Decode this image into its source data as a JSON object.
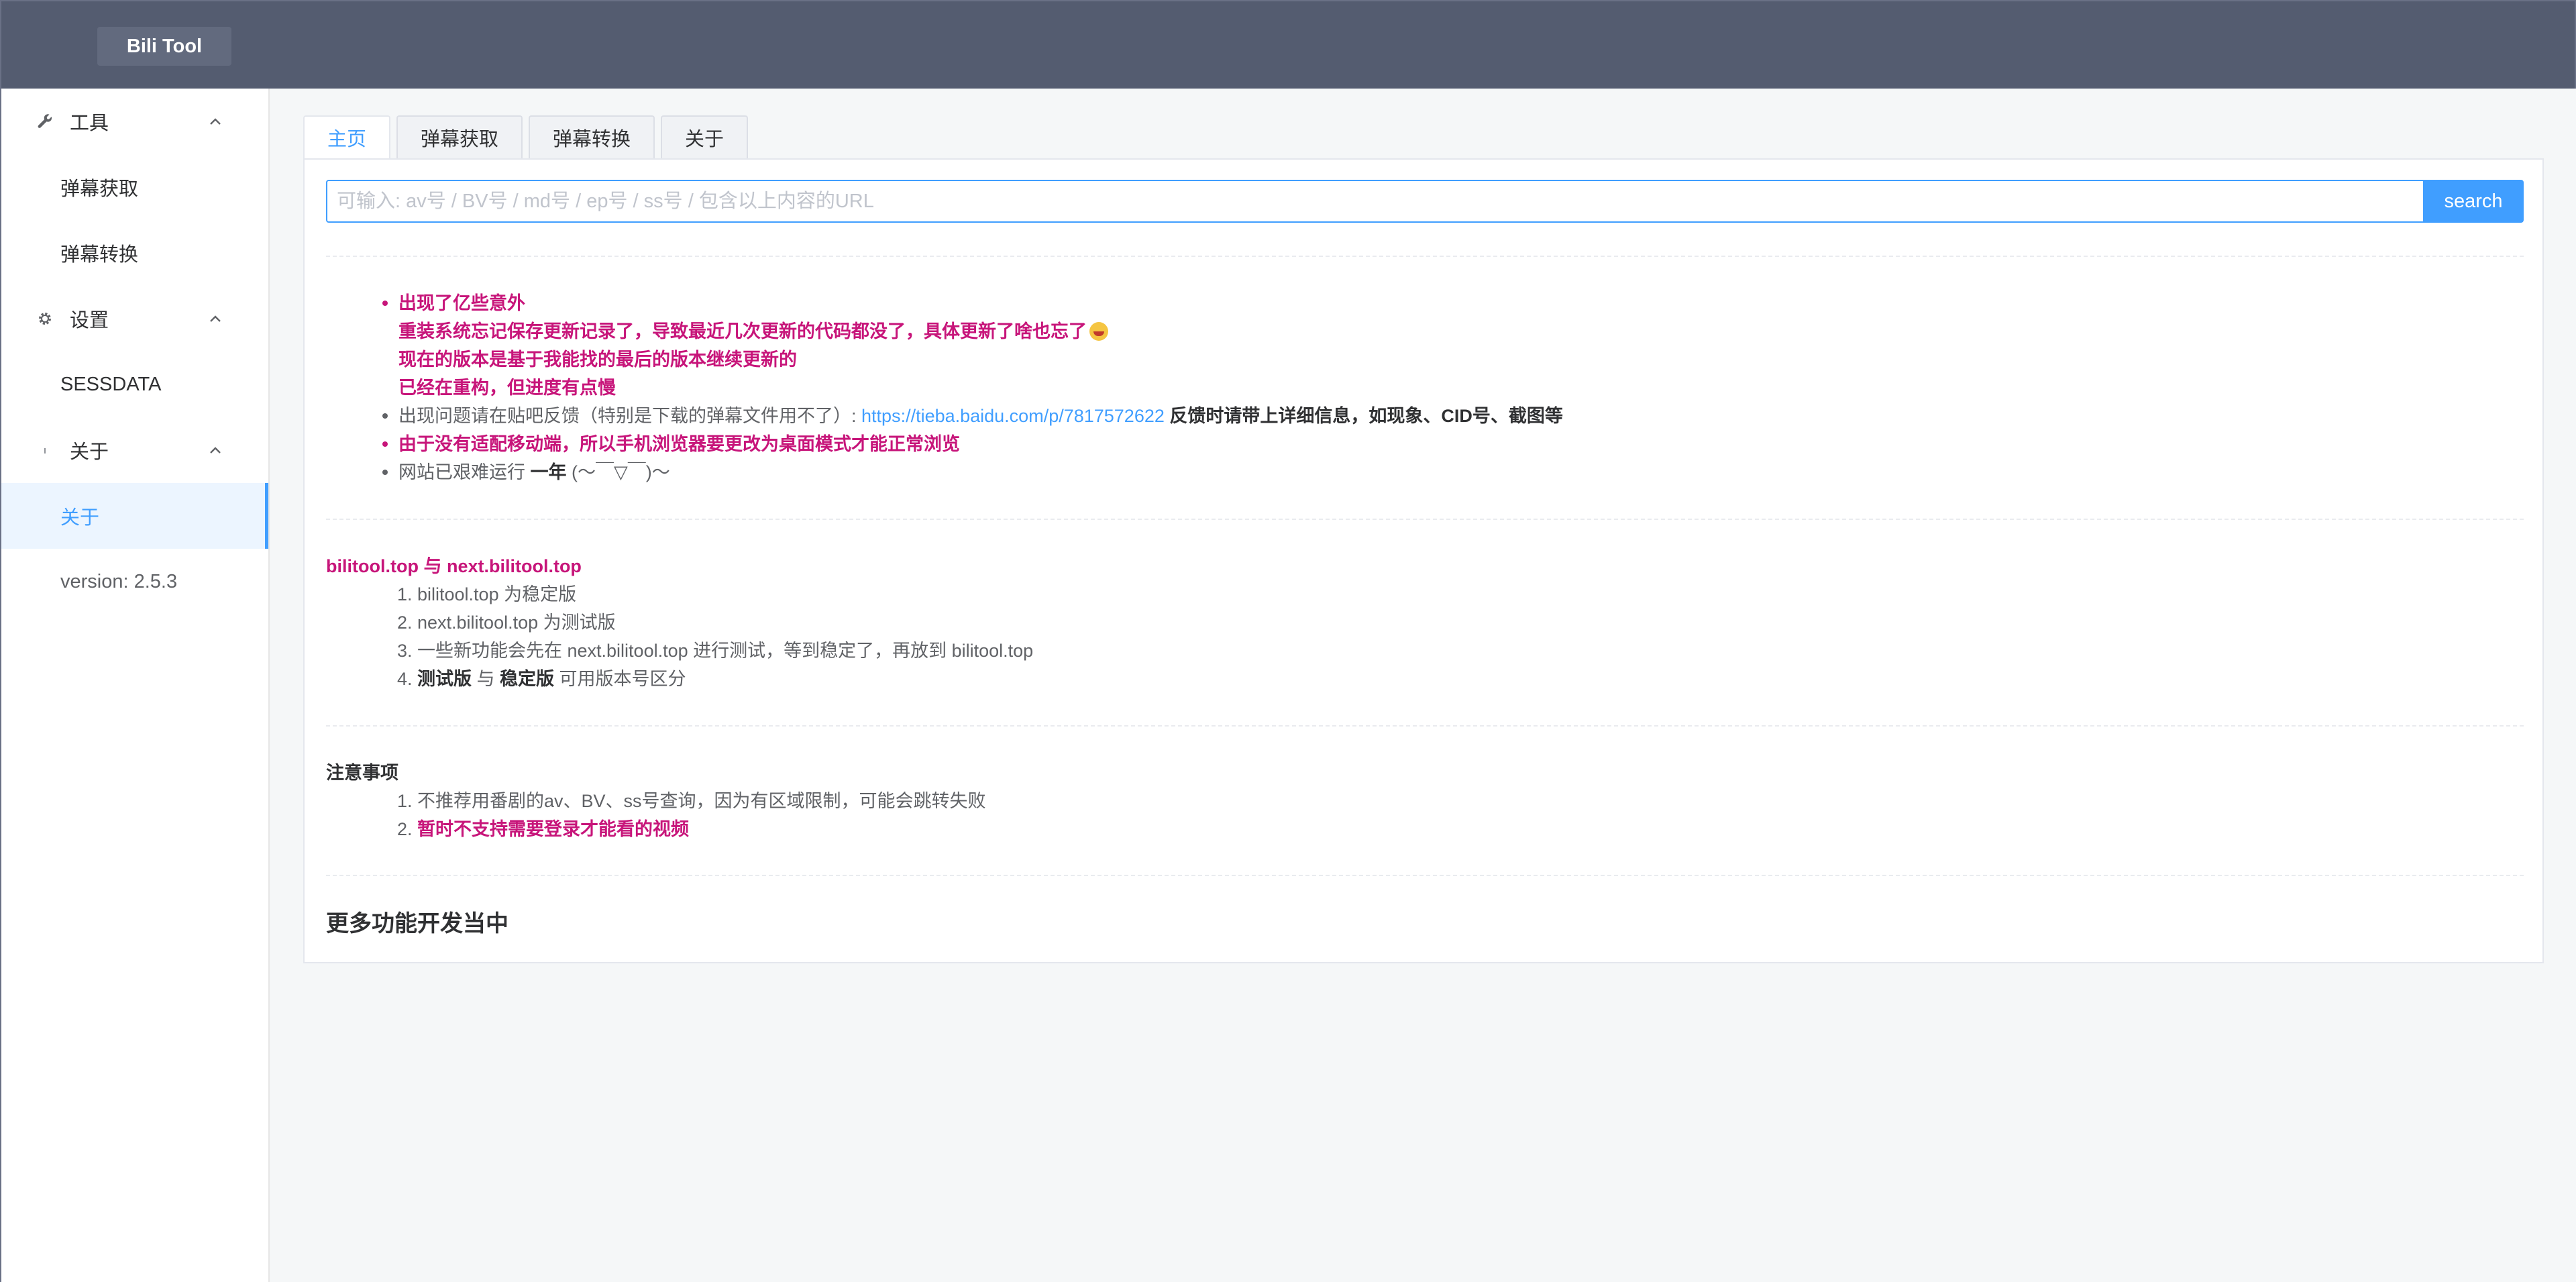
{
  "header": {
    "brand": "Bili Tool"
  },
  "sidebar": {
    "groups": [
      {
        "title": "工具",
        "icon": "wrench-icon",
        "items": [
          {
            "label": "弹幕获取"
          },
          {
            "label": "弹幕转换"
          }
        ]
      },
      {
        "title": "设置",
        "icon": "gear-icon",
        "items": [
          {
            "label": "SESSDATA"
          }
        ]
      },
      {
        "title": "关于",
        "icon": "info-icon",
        "items": [
          {
            "label": "关于",
            "active": true
          }
        ]
      }
    ],
    "version": "version: 2.5.3"
  },
  "tabs": [
    {
      "label": "主页",
      "active": true
    },
    {
      "label": "弹幕获取"
    },
    {
      "label": "弹幕转换"
    },
    {
      "label": "关于"
    }
  ],
  "search": {
    "placeholder": "可输入: av号 / BV号 / md号 / ep号 / ss号 / 包含以上内容的URL",
    "value": "",
    "button": "search"
  },
  "notes": {
    "item1_line1": "出现了亿些意外",
    "item1_line2": "重装系统忘记保存更新记录了，导致最近几次更新的代码都没了，具体更新了啥也忘了",
    "item1_line3": "现在的版本是基于我能找的最后的版本继续更新的",
    "item1_line4": "已经在重构，但进度有点慢",
    "item2_text": "出现问题请在贴吧反馈（特别是下载的弹幕文件用不了）:",
    "item2_link": "https://tieba.baidu.com/p/7817572622",
    "item2_bold": "反馈时请带上详细信息，如现象、CID号、截图等",
    "item3": "由于没有适配移动端，所以手机浏览器要更改为桌面模式才能正常浏览",
    "item4_pre": "网站已艰难运行",
    "item4_bold": "一年",
    "item4_post": "(〜￣▽￣)〜"
  },
  "versions": {
    "title": "bilitool.top 与 next.bilitool.top",
    "items": [
      "bilitool.top 为稳定版",
      "next.bilitool.top 为测试版",
      "一些新功能会先在 next.bilitool.top 进行测试，等到稳定了，再放到 bilitool.top"
    ],
    "item4_b1": "测试版",
    "item4_mid": "与",
    "item4_b2": "稳定版",
    "item4_post": "可用版本号区分",
    "nums": [
      "1.",
      "2.",
      "3.",
      "4."
    ]
  },
  "notice": {
    "title": "注意事项",
    "item1": "不推荐用番剧的av、BV、ss号查询，因为有区域限制，可能会跳转失败",
    "item2": "暂时不支持需要登录才能看的视频",
    "nums": [
      "1.",
      "2."
    ]
  },
  "footer_title": "更多功能开发当中",
  "colors": {
    "header": "#545c70",
    "accent": "#409eff",
    "pink": "#c7157a"
  }
}
